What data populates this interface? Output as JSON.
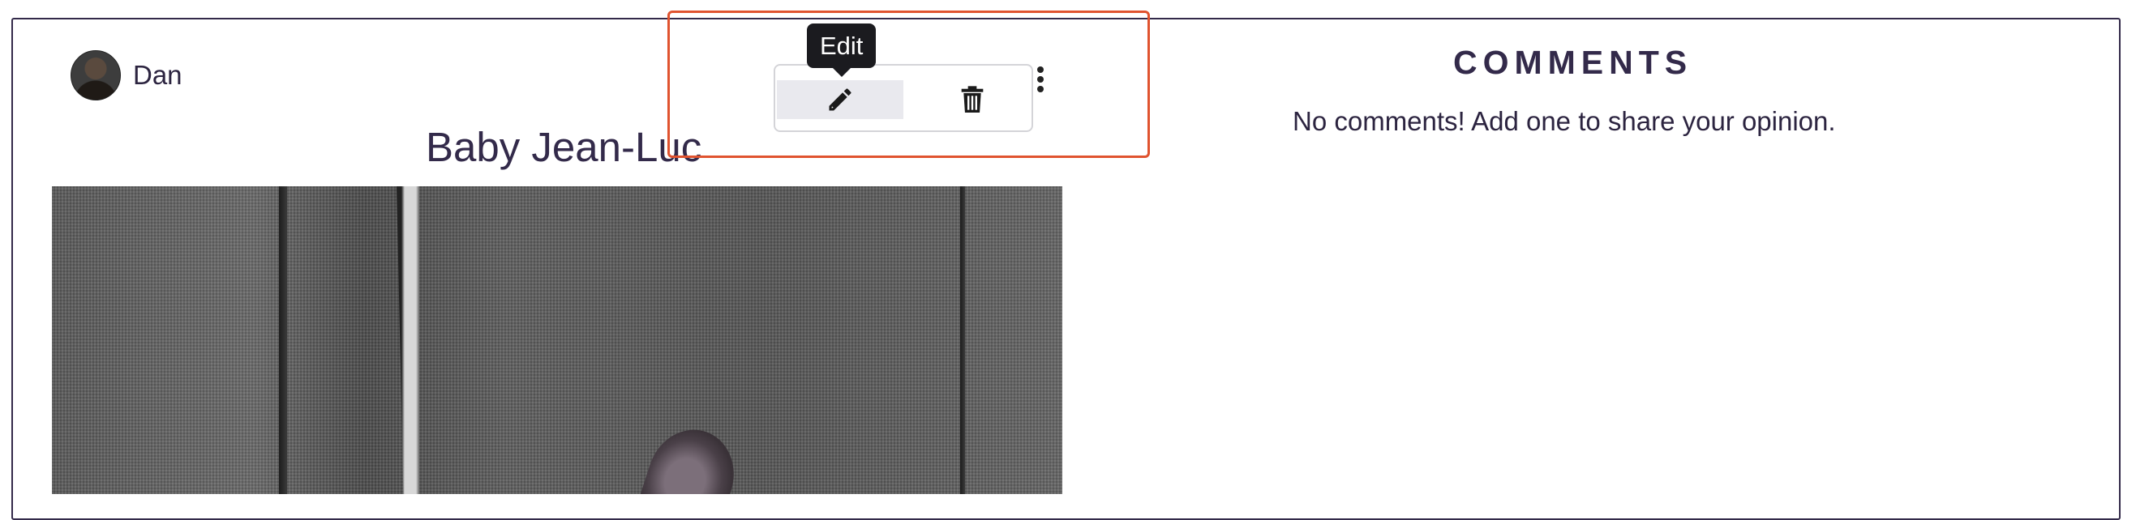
{
  "post": {
    "author_name": "Dan",
    "title": "Baby Jean-Luc"
  },
  "toolbar": {
    "edit_tooltip": "Edit",
    "icons": [
      "pencil-icon",
      "trash-icon",
      "kebab-menu-icon"
    ]
  },
  "comments": {
    "heading": "COMMENTS",
    "empty_message": "No comments! Add one to share your opinion."
  },
  "colors": {
    "text": "#332a4a",
    "tooltip_bg": "#1b1b1f",
    "highlight": "#e0532f",
    "active_button_bg": "#e9e9ee"
  }
}
